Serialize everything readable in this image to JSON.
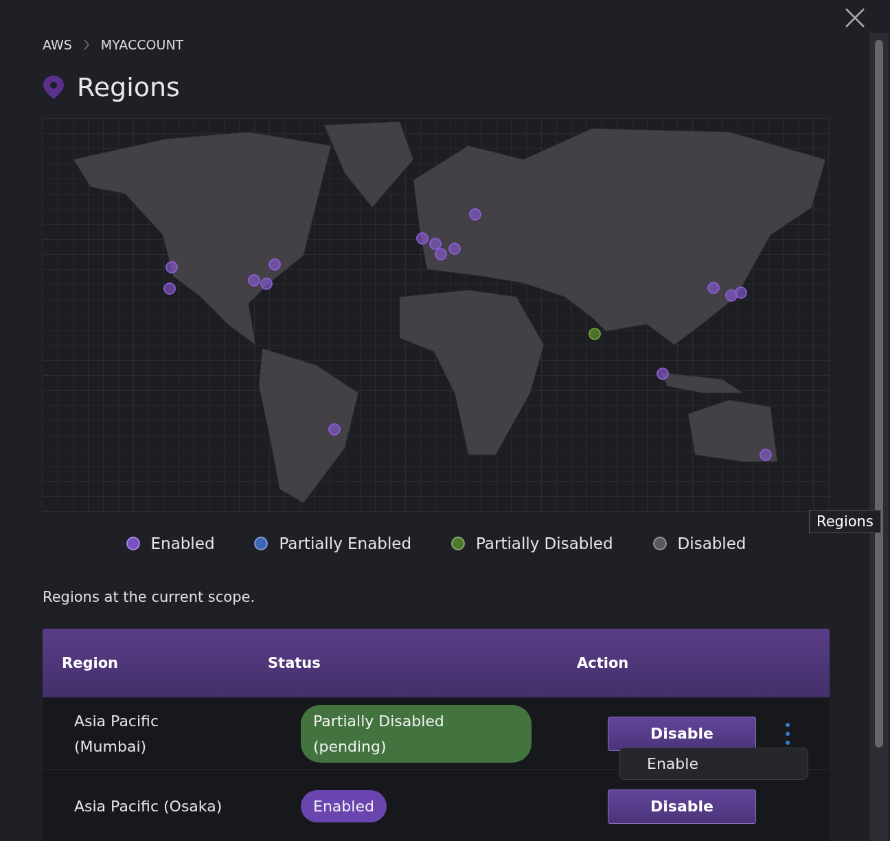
{
  "breadcrumb": [
    "AWS",
    "MYACCOUNT"
  ],
  "title": "Regions",
  "map_pins": [
    {
      "color": "#8a5cd6"
    },
    {
      "color": "#8a5cd6"
    },
    {
      "color": "#8a5cd6"
    },
    {
      "color": "#8a5cd6"
    },
    {
      "color": "#8a5cd6"
    },
    {
      "color": "#8a5cd6"
    },
    {
      "color": "#8a5cd6"
    },
    {
      "color": "#8a5cd6"
    },
    {
      "color": "#8a5cd6"
    },
    {
      "color": "#8a5cd6"
    },
    {
      "color": "#8a5cd6"
    },
    {
      "color": "#6aa332"
    },
    {
      "color": "#8a5cd6"
    },
    {
      "color": "#8a5cd6"
    },
    {
      "color": "#8a5cd6"
    },
    {
      "color": "#8a5cd6"
    },
    {
      "color": "#8a5cd6"
    }
  ],
  "legend": [
    {
      "label": "Enabled",
      "color": "#7a4fc4"
    },
    {
      "label": "Partially Enabled",
      "color": "#3f67b8"
    },
    {
      "label": "Partially Disabled",
      "color": "#4a7a2a"
    },
    {
      "label": "Disabled",
      "color": "#5a5a5e"
    }
  ],
  "description": "Regions at the current scope.",
  "table": {
    "columns": [
      "Region",
      "Status",
      "Action"
    ],
    "rows": [
      {
        "region": "Asia Pacific (Mumbai)",
        "status": "Partially Disabled (pending)",
        "color": "#437440",
        "action": "Disable",
        "menu": true
      },
      {
        "region": "Asia Pacific (Osaka)",
        "status": "Enabled",
        "color": "#6a45b0",
        "action": "Disable",
        "menu": false
      }
    ]
  },
  "menu_items": [
    "Enable"
  ],
  "tooltip": "Regions"
}
